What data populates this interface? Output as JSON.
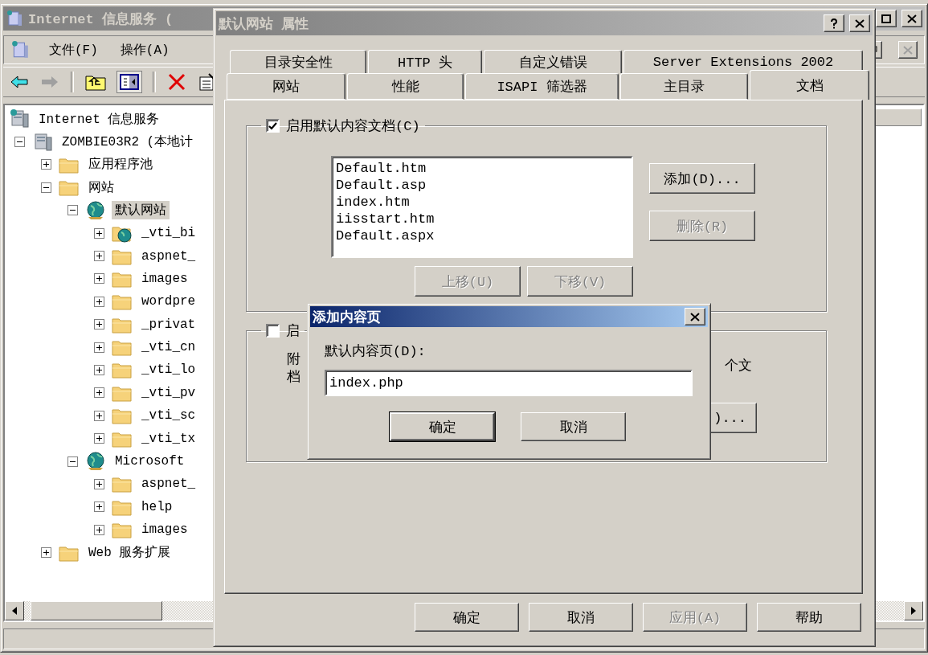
{
  "main_window": {
    "title": "Internet 信息服务 (",
    "active": false,
    "menu": [
      "文件(F)",
      "操作(A)"
    ],
    "tree": [
      {
        "label": "Internet 信息服务",
        "kind": "root",
        "selected": false,
        "children": [
          {
            "label": "ZOMBIE03R2 (本地计",
            "kind": "server",
            "expanded": true,
            "selected": false,
            "children": [
              {
                "label": "应用程序池",
                "kind": "folder",
                "expanded": false,
                "selected": false
              },
              {
                "label": "网站",
                "kind": "folder",
                "expanded": true,
                "selected": false,
                "children": [
                  {
                    "label": "默认网站",
                    "kind": "site",
                    "expanded": true,
                    "selected": true,
                    "children": [
                      {
                        "label": "_vti_bi",
                        "kind": "vdir",
                        "expanded": false,
                        "selected": false
                      },
                      {
                        "label": "aspnet_",
                        "kind": "folder",
                        "expanded": false,
                        "selected": false
                      },
                      {
                        "label": "images",
                        "kind": "folder",
                        "expanded": false,
                        "selected": false
                      },
                      {
                        "label": "wordpre",
                        "kind": "folder",
                        "expanded": false,
                        "selected": false
                      },
                      {
                        "label": "_privat",
                        "kind": "folder",
                        "expanded": false,
                        "selected": false
                      },
                      {
                        "label": "_vti_cn",
                        "kind": "folder",
                        "expanded": false,
                        "selected": false
                      },
                      {
                        "label": "_vti_lo",
                        "kind": "folder",
                        "expanded": false,
                        "selected": false
                      },
                      {
                        "label": "_vti_pv",
                        "kind": "folder",
                        "expanded": false,
                        "selected": false
                      },
                      {
                        "label": "_vti_sc",
                        "kind": "folder",
                        "expanded": false,
                        "selected": false
                      },
                      {
                        "label": "_vti_tx",
                        "kind": "folder",
                        "expanded": false,
                        "selected": false
                      }
                    ]
                  },
                  {
                    "label": "Microsoft",
                    "kind": "site",
                    "expanded": true,
                    "selected": false,
                    "children": [
                      {
                        "label": "aspnet_",
                        "kind": "folder",
                        "expanded": false,
                        "selected": false
                      },
                      {
                        "label": "help",
                        "kind": "folder",
                        "expanded": false,
                        "selected": false
                      },
                      {
                        "label": "images",
                        "kind": "folder",
                        "expanded": false,
                        "selected": false
                      }
                    ]
                  }
                ]
              },
              {
                "label": "Web 服务扩展",
                "kind": "folder",
                "expanded": false,
                "selected": false
              }
            ]
          }
        ]
      }
    ]
  },
  "properties_dialog": {
    "title": "默认网站 属性",
    "active": false,
    "tab_rows": [
      [
        {
          "label": "目录安全性",
          "selected": false
        },
        {
          "label": "HTTP 头",
          "selected": false
        },
        {
          "label": "自定义错误",
          "selected": false
        },
        {
          "label": "Server Extensions 2002",
          "selected": false
        }
      ],
      [
        {
          "label": "网站",
          "selected": false
        },
        {
          "label": "性能",
          "selected": false
        },
        {
          "label": "ISAPI 筛选器",
          "selected": false
        },
        {
          "label": "主目录",
          "selected": false
        },
        {
          "label": "文档",
          "selected": true
        }
      ]
    ],
    "default_docs": {
      "label": "启用默认内容文档(C)",
      "checked": true,
      "documents": [
        "Default.htm",
        "Default.asp",
        "index.htm",
        "iisstart.htm",
        "Default.aspx"
      ],
      "side_buttons": [
        {
          "label": "添加(D)...",
          "disabled": false
        },
        {
          "label": "删除(R)",
          "disabled": true
        }
      ],
      "move_buttons": [
        {
          "label": "上移(U)",
          "disabled": true
        },
        {
          "label": "下移(V)",
          "disabled": true
        }
      ]
    },
    "footer_group": {
      "label": "启",
      "checked": false,
      "text_left": [
        "附",
        "档"
      ],
      "text_right": "个文",
      "button": {
        "label": ")...",
        "disabled": false
      }
    },
    "buttons": [
      {
        "label": "确定",
        "disabled": false
      },
      {
        "label": "取消",
        "disabled": false
      },
      {
        "label": "应用(A)",
        "disabled": true
      },
      {
        "label": "帮助",
        "disabled": false
      }
    ]
  },
  "add_dialog": {
    "title": "添加内容页",
    "active": true,
    "field_label": "默认内容页(D):",
    "value": "index.php",
    "buttons": [
      {
        "label": "确定",
        "default": true
      },
      {
        "label": "取消",
        "default": false
      }
    ]
  }
}
